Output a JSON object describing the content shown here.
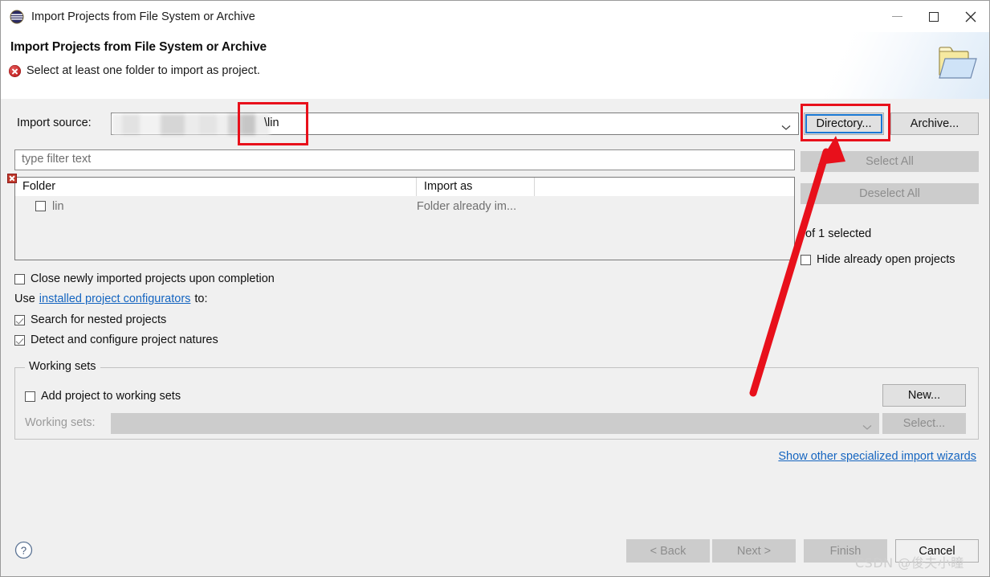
{
  "window": {
    "title": "Import Projects from File System or Archive",
    "icon": "eclipse-icon",
    "controls": {
      "minimize": "–",
      "maximize": "□",
      "close": "✕"
    }
  },
  "header": {
    "title": "Import Projects from File System or Archive",
    "message": "Select at least one folder to import as project.",
    "message_icon": "error-icon",
    "banner_icon": "folder-icon"
  },
  "form": {
    "import_source_label": "Import source:",
    "import_source_value": "\\lin",
    "import_source_redacted": true,
    "filter_placeholder": "type filter text",
    "directory_button": "Directory...",
    "archive_button": "Archive...",
    "select_all_button": "Select All",
    "deselect_all_button": "Deselect All",
    "selection_status": "of 1 selected",
    "hide_open_projects_label": "Hide already open projects",
    "hide_open_projects_checked": false
  },
  "table": {
    "columns": [
      "Folder",
      "Import as",
      ""
    ],
    "rows": [
      {
        "checked": false,
        "folder": "lin",
        "import_as": "Folder already im..."
      }
    ]
  },
  "options": {
    "close_imported": {
      "label": "Close newly imported projects upon completion",
      "checked": false
    },
    "use_line_prefix": "Use",
    "configurators_link": "installed project configurators",
    "use_line_suffix": "to:",
    "search_nested": {
      "label": "Search for nested projects",
      "checked": true
    },
    "detect_natures": {
      "label": "Detect and configure project natures",
      "checked": true
    }
  },
  "working_sets": {
    "legend": "Working sets",
    "add_label": "Add project to working sets",
    "add_checked": false,
    "combo_label": "Working sets:",
    "combo_value": "",
    "new_button": "New...",
    "select_button": "Select..."
  },
  "links": {
    "show_other_wizards": "Show other specialized import wizards"
  },
  "footer": {
    "help_icon": "help-icon",
    "back_button": "< Back",
    "next_button": "Next >",
    "finish_button": "Finish",
    "cancel_button": "Cancel"
  },
  "annotations": {
    "arrow_color": "#e8101b",
    "box_color": "#e8101b",
    "focus_color": "#1a78d4"
  },
  "watermark": "CSDN @俊夫小瞳"
}
